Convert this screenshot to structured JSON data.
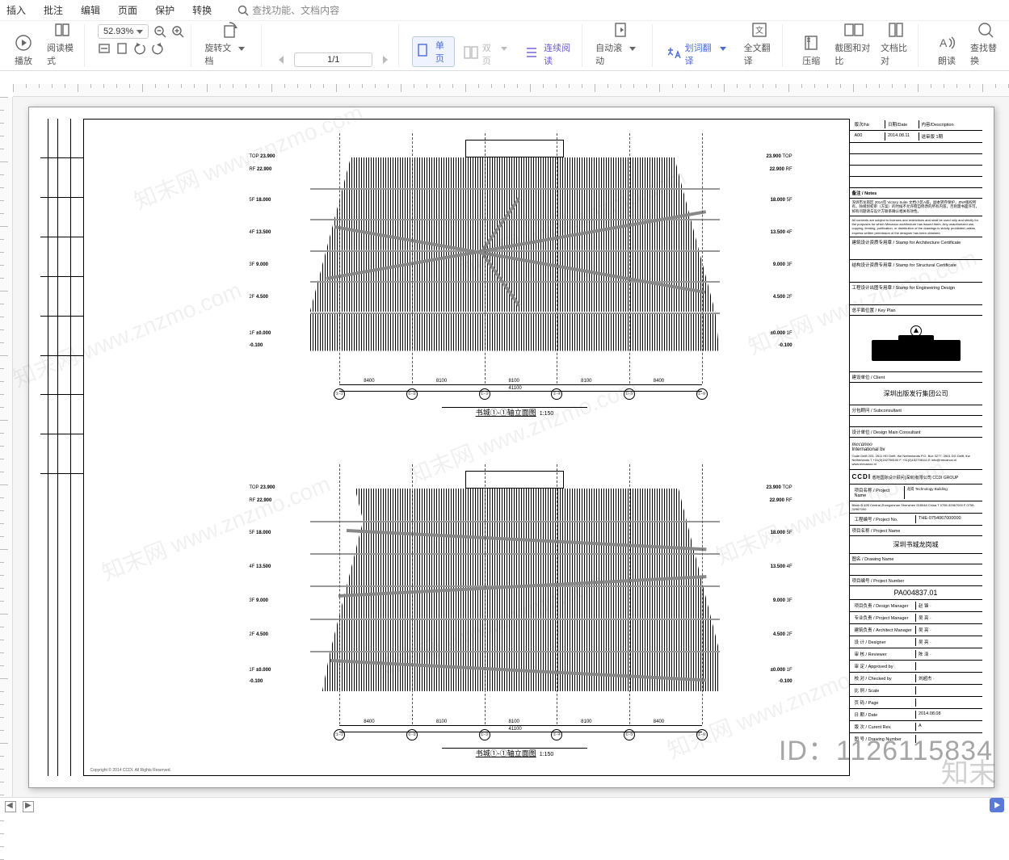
{
  "menu": {
    "items": [
      "插入",
      "批注",
      "编辑",
      "页面",
      "保护",
      "转换"
    ],
    "search_placeholder": "查找功能、文档内容"
  },
  "toolbar": {
    "play": "播放",
    "read_mode": "阅读模式",
    "zoom_value": "52.93%",
    "rotate": "旋转文档",
    "page_indicator": "1/1",
    "single": "单页",
    "double": "双页",
    "continuous": "连续阅读",
    "autoscroll": "自动滚动",
    "word_trans": "划词翻译",
    "full_trans": "全文翻译",
    "compress": "压缩",
    "screenshot_compare": "截图和对比",
    "doc_compare": "文档比对",
    "read_aloud": "朗读",
    "find_replace": "查找替换"
  },
  "drawing": {
    "elev_title": "书城①-①轴立面图",
    "elev_scale": "1:150",
    "floors": [
      {
        "tag": "TOP",
        "lvl": "23.900"
      },
      {
        "tag": "RF",
        "lvl": "22.900"
      },
      {
        "tag": "5F",
        "lvl": "18.000"
      },
      {
        "tag": "4F",
        "lvl": "13.500"
      },
      {
        "tag": "3F",
        "lvl": "9.000"
      },
      {
        "tag": "2F",
        "lvl": "4.500"
      },
      {
        "tag": "1F",
        "lvl": "±0.000"
      },
      {
        "tag": "",
        "lvl": "-0.100"
      }
    ],
    "grid_axes": [
      "①-①",
      "①-②",
      "①-③",
      "①-④",
      "①-⑤",
      "①-⑥"
    ],
    "bay_dims": [
      "8400",
      "8100",
      "8100",
      "8100",
      "8400"
    ],
    "total_dim": "41100"
  },
  "titleblock": {
    "rev_header": {
      "no": "版次/№",
      "date": "日期/Date",
      "desc": "内容/Description"
    },
    "rev_rows": [
      {
        "no": "A00",
        "date": "2014.08.11",
        "desc": "送审版 1期"
      }
    ],
    "notes_label": "备注 / Notes",
    "notes_cn": "深圳市龙岗区 2014年 Victory Suite 文档小区A座，副本转存保护，ZN#版权所有。除规划初审（方案）的时候不允许擅自修改的所有内容，否则需书面许可，如有问题请与设计方联系确认相关有效性。",
    "notes_en": "All contents are subject to licenses and restrictions and shall be used only and strictly for the purposes for which Mecanoo architecture has issued them. Any unauthorized use, copying, lending, publication, or distribution of the drawings is strictly prohibited unless express written permission of the designer has been obtained.",
    "arch_stamp": "建筑设计资质专用章 / Stamp for Architecture Certificate",
    "struct_stamp": "结构设计资质专用章 / Stamp for Structural Certificate",
    "eng_stamp": "工程设计出图专用章 / Stamp for Engineering Design",
    "keyplan_label": "总平面位置 / Key Plan",
    "client_label": "建设单位 / Client",
    "client_name": "深圳出版发行集团公司",
    "subconsult_label": "分包顾问 / Subconsultant",
    "designer_label": "设计单位 / Design Main Consultant",
    "designer_name1": "mecanoo",
    "designer_name2": "International bv",
    "designer_addr": "Oude Delft 203, 2611 HD Delft, the Netherlands  P.O. Box 3277, 2601 DG Delft, the Netherlands  T +31(0)152798100 F +31(0)152798111  E info@mecanoo.nl  www.mecanoo.nl",
    "cci_name": "悉地国际设计顾问(深圳)有限公司  CCDI GROUP",
    "proj_name_label": "项目名称 / Project Name",
    "proj_name_cn": "龙岗 Technology Building",
    "proj_addr": "Block B 426 Central Zhongxinnan Shenzhen 518048 China  T 0755-32967000  F 0755-32967000",
    "proj_no_label": "工程编号 / Project No.",
    "proj_no": "THE-0754067000000",
    "proj_title_label": "项目名称 / Project Name",
    "proj_title": "深圳书城龙岗城",
    "dwg_title_label": "图名 / Drawing Name",
    "dwg_title": "",
    "dwg_no_label": "项目编号 / Project Number",
    "dwg_no": "PA004837.01",
    "table": {
      "design_mgr": {
        "label": "项目负责 / Design Manager",
        "val": "赵 锋 ·"
      },
      "proj_mgr": {
        "label": "专业负责 / Project Manager",
        "val": "吴 亮 ·"
      },
      "arch_mgr": {
        "label": "建筑负责 / Architect Manager",
        "val": "吴 亮 ·"
      },
      "designer": {
        "label": "设 计 / Designer",
        "val": "吴 亮 ·"
      },
      "reviewer": {
        "label": "审 核 / Reviewer",
        "val": "陈 泽 ·"
      },
      "approved": {
        "label": "审 定 / Approved by",
        "val": ""
      },
      "checked": {
        "label": "校 对 / Checked by",
        "val": "刘超杰 ·"
      },
      "scale": {
        "label": "比 例 / Scale",
        "val": ""
      },
      "page": {
        "label": "页 码 / Page",
        "val": ""
      },
      "date": {
        "label": "日 期 / Date",
        "val": "2014.08.08"
      },
      "edition": {
        "label": "版 次 / Curent Rev.",
        "val": "A"
      },
      "drawing_no": {
        "label": "图 号 / Drawing Number",
        "val": ""
      }
    }
  },
  "footer_note": "Copyright © 2014 CCDI. All Rights Reserved.",
  "id_watermark": "ID：1126115834",
  "brand_watermark": "知末",
  "wm_text": "知末网 www.znzmo.com"
}
